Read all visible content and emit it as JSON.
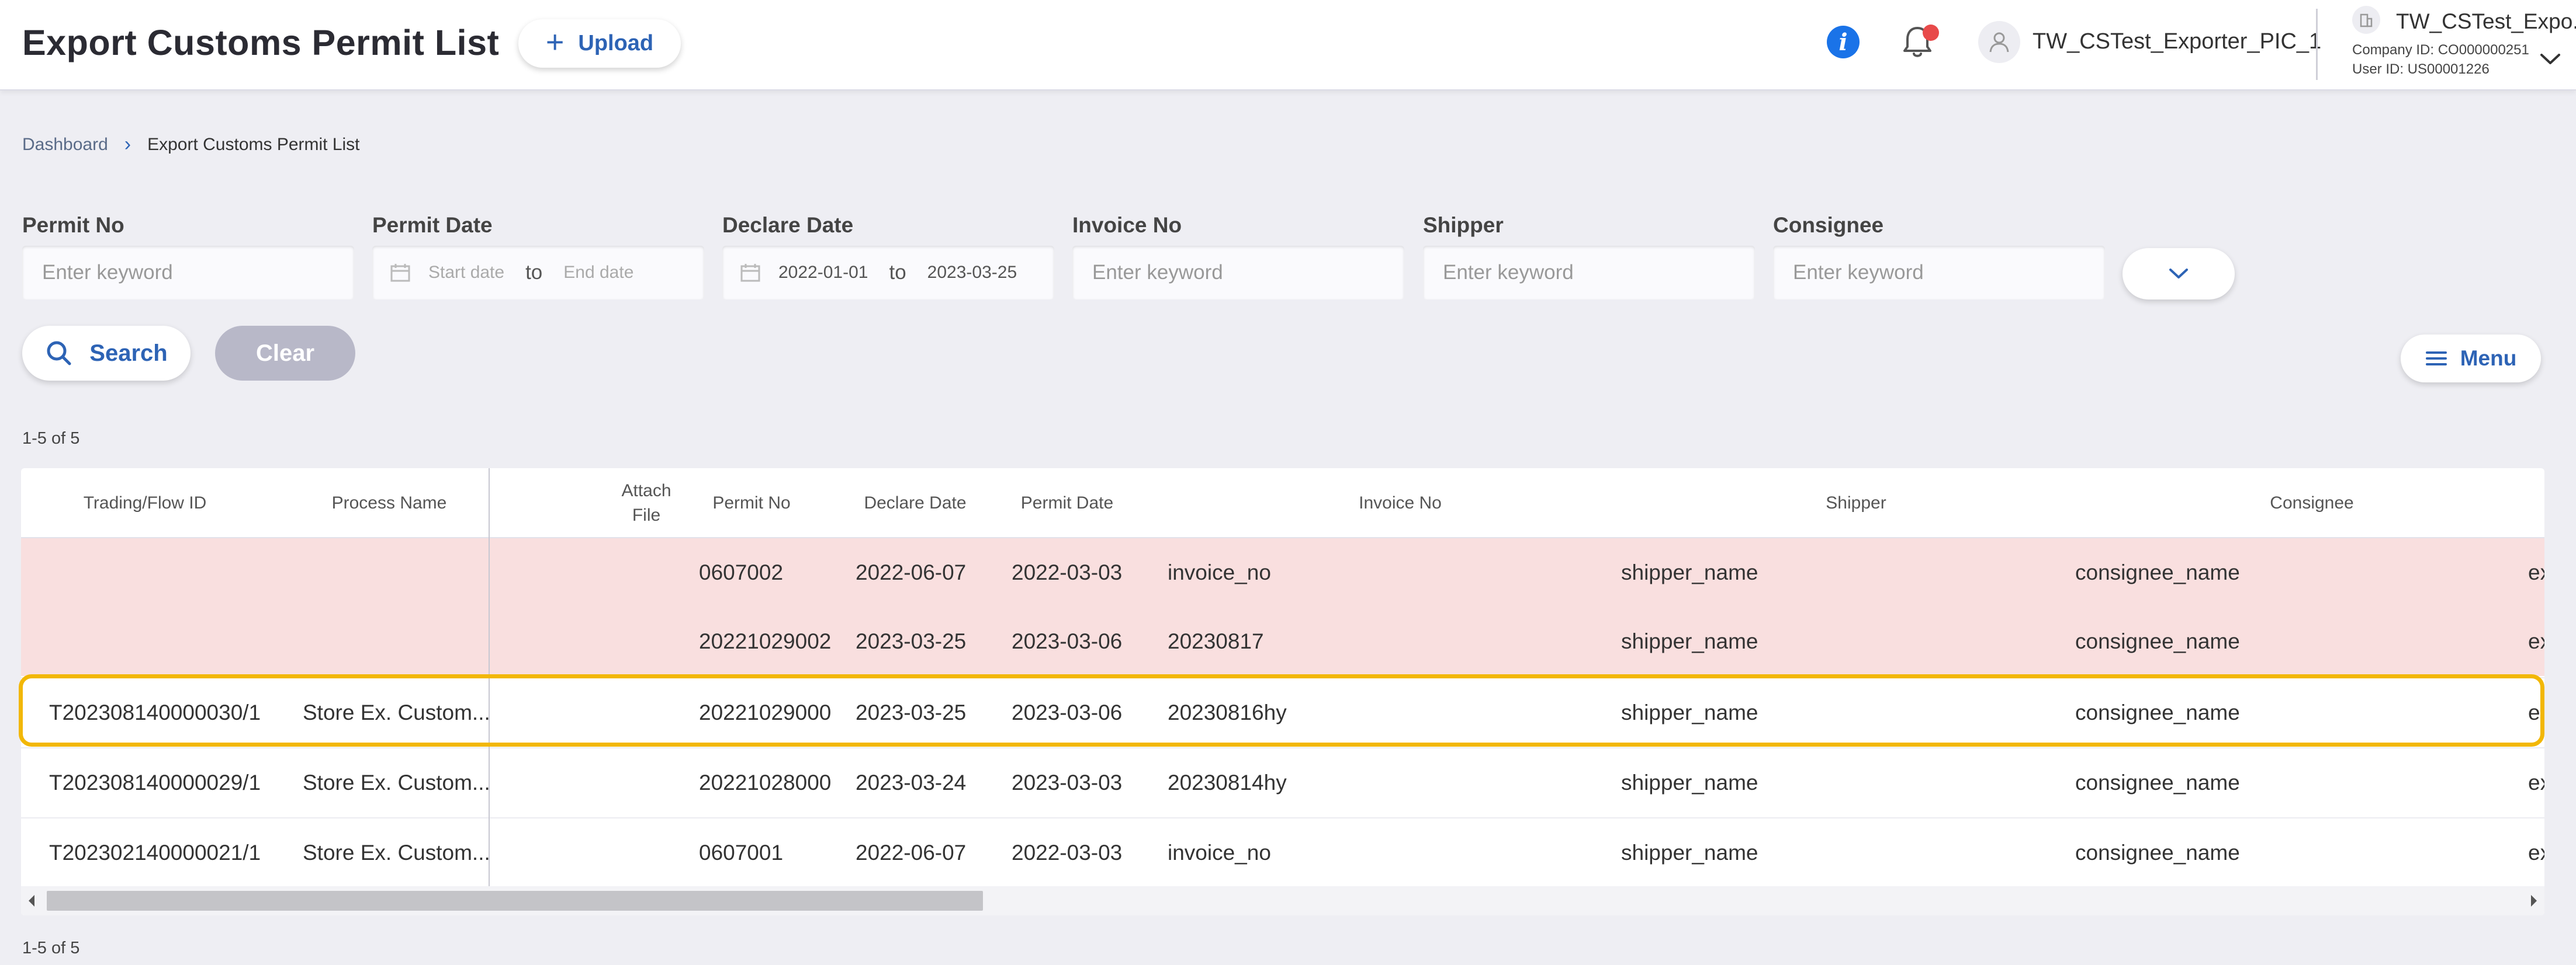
{
  "header": {
    "title": "Export Customs Permit List",
    "upload_label": "Upload",
    "user_name": "TW_CSTest_Exporter_PIC_1",
    "company_name": "TW_CSTest_Expo...",
    "company_id": "Company ID: CO000000251",
    "user_id": "User ID: US00001226"
  },
  "breadcrumb": {
    "home": "Dashboard",
    "current": "Export Customs Permit List"
  },
  "filters": {
    "permit_no": {
      "label": "Permit No",
      "placeholder": "Enter keyword"
    },
    "permit_date": {
      "label": "Permit Date",
      "start_placeholder": "Start date",
      "to": "to",
      "end_placeholder": "End date"
    },
    "declare_date": {
      "label": "Declare Date",
      "start": "2022-01-01",
      "to": "to",
      "end": "2023-03-25"
    },
    "invoice_no": {
      "label": "Invoice No",
      "placeholder": "Enter keyword"
    },
    "shipper": {
      "label": "Shipper",
      "placeholder": "Enter keyword"
    },
    "consignee": {
      "label": "Consignee",
      "placeholder": "Enter keyword"
    }
  },
  "actions": {
    "search_label": "Search",
    "clear_label": "Clear",
    "menu_label": "Menu"
  },
  "pagination": {
    "count_top": "1-5 of 5",
    "count_bottom": "1-5 of 5"
  },
  "table": {
    "columns": {
      "trading_id": "Trading/Flow ID",
      "process_name": "Process Name",
      "attach_file_1": "Attach",
      "attach_file_2": "File",
      "permit_no": "Permit No",
      "declare_date": "Declare Date",
      "permit_date": "Permit Date",
      "invoice_no": "Invoice No",
      "shipper": "Shipper",
      "consignee": "Consignee"
    },
    "rows": [
      {
        "trading_id": "",
        "process_name": "",
        "permit_no": "0607002",
        "declare_date": "2022-06-07",
        "permit_date": "2022-03-03",
        "invoice_no": "invoice_no",
        "shipper": "shipper_name",
        "consignee": "consignee_name",
        "overflow": "ex"
      },
      {
        "trading_id": "",
        "process_name": "",
        "permit_no": "20221029002",
        "declare_date": "2023-03-25",
        "permit_date": "2023-03-06",
        "invoice_no": "20230817",
        "shipper": "shipper_name",
        "consignee": "consignee_name",
        "overflow": "ex"
      },
      {
        "trading_id": "T202308140000030/1",
        "process_name": "Store Ex. Custom...",
        "permit_no": "20221029000",
        "declare_date": "2023-03-25",
        "permit_date": "2023-03-06",
        "invoice_no": "20230816hy",
        "shipper": "shipper_name",
        "consignee": "consignee_name",
        "overflow": "e"
      },
      {
        "trading_id": "T202308140000029/1",
        "process_name": "Store Ex. Custom...",
        "permit_no": "20221028000",
        "declare_date": "2023-03-24",
        "permit_date": "2023-03-03",
        "invoice_no": "20230814hy",
        "shipper": "shipper_name",
        "consignee": "consignee_name",
        "overflow": "ex"
      },
      {
        "trading_id": "T202302140000021/1",
        "process_name": "Store Ex. Custom...",
        "permit_no": "0607001",
        "declare_date": "2022-06-07",
        "permit_date": "2022-03-03",
        "invoice_no": "invoice_no",
        "shipper": "shipper_name",
        "consignee": "consignee_name",
        "overflow": "ex"
      }
    ]
  },
  "colors": {
    "accent": "#2d63b5",
    "highlight_row": "#f9dfdf",
    "selection_outline": "#f2b705",
    "notification_dot": "#e84a4a",
    "info": "#1a73e8"
  }
}
